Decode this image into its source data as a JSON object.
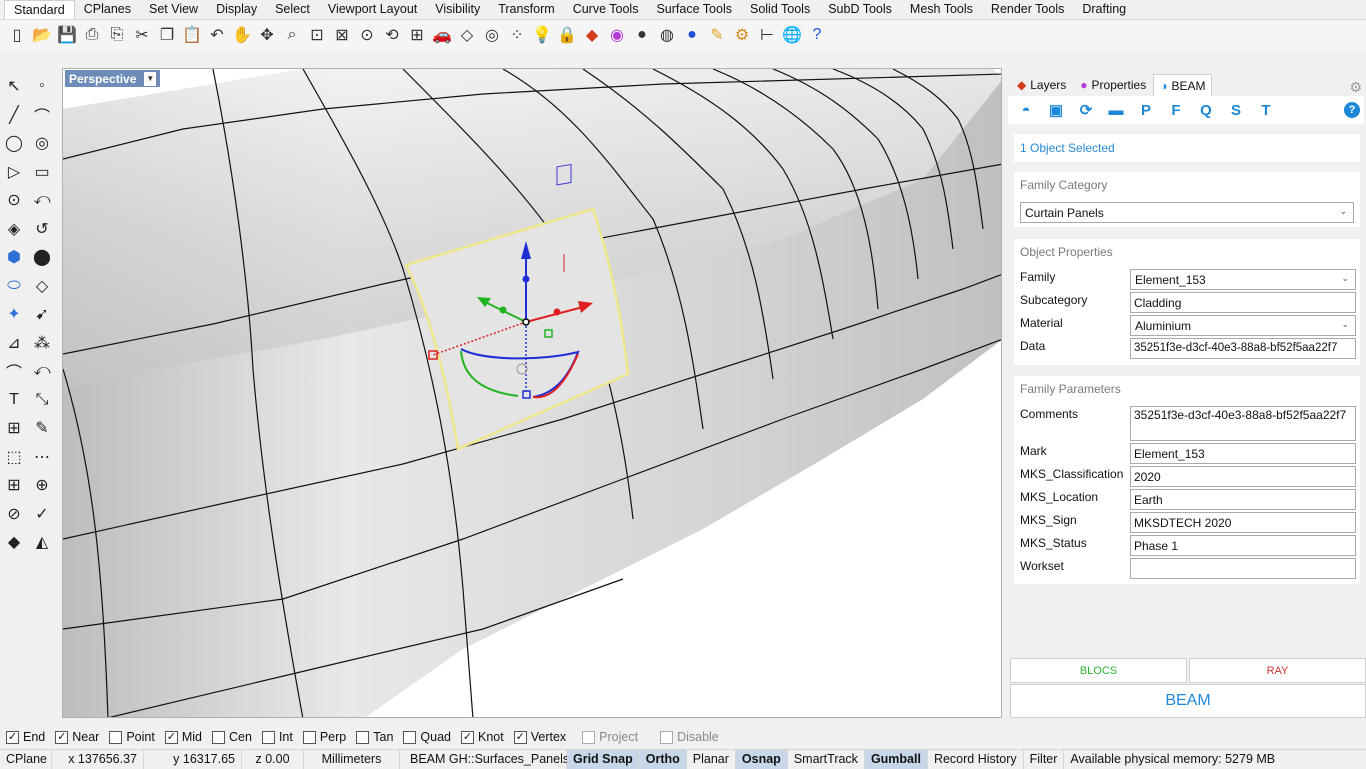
{
  "tabs": [
    "Standard",
    "CPlanes",
    "Set View",
    "Display",
    "Select",
    "Viewport Layout",
    "Visibility",
    "Transform",
    "Curve Tools",
    "Surface Tools",
    "Solid Tools",
    "SubD Tools",
    "Mesh Tools",
    "Render Tools",
    "Drafting"
  ],
  "toolbar_icons": [
    "new-file",
    "open",
    "save",
    "print",
    "import",
    "cut",
    "copy",
    "paste",
    "undo",
    "pan",
    "rotate-view",
    "zoom",
    "zoom-window",
    "zoom-extents",
    "zoom-selected",
    "rotate",
    "four-viewports",
    "car",
    "construction-plane",
    "circle-snap",
    "point-select",
    "light",
    "lock",
    "layer",
    "color-wheel",
    "sphere-shade",
    "sphere-render",
    "sphere-blue",
    "brush",
    "gear",
    "dimension",
    "globe",
    "help"
  ],
  "viewport": {
    "label": "Perspective"
  },
  "right_panel": {
    "tabs": [
      "Layers",
      "Properties",
      "BEAM"
    ],
    "beam_letters": [
      "P",
      "F",
      "Q",
      "S",
      "T"
    ],
    "selection": "1 Object Selected",
    "family_category": {
      "title": "Family Category",
      "value": "Curtain Panels"
    },
    "object_properties": {
      "title": "Object Properties",
      "family_label": "Family",
      "family_value": "Element_153",
      "subcategory_label": "Subcategory",
      "subcategory_value": "Cladding",
      "material_label": "Material",
      "material_value": "Aluminium",
      "data_label": "Data",
      "data_value": "35251f3e-d3cf-40e3-88a8-bf52f5aa22f7"
    },
    "family_parameters": {
      "title": "Family Parameters",
      "comments_label": "Comments",
      "comments_value": "35251f3e-d3cf-40e3-88a8-bf52f5aa22f7",
      "mark_label": "Mark",
      "mark_value": "Element_153",
      "classification_label": "MKS_Classification",
      "classification_value": "2020",
      "location_label": "MKS_Location",
      "location_value": "Earth",
      "sign_label": "MKS_Sign",
      "sign_value": "MKSDTECH 2020",
      "status_label": "MKS_Status",
      "status_value": "Phase 1",
      "workset_label": "Workset",
      "workset_value": ""
    },
    "buttons": {
      "blocs": "BLOCS",
      "ray": "RAY",
      "beam": "BEAM"
    }
  },
  "osnaps": [
    {
      "label": "End",
      "checked": true
    },
    {
      "label": "Near",
      "checked": true
    },
    {
      "label": "Point",
      "checked": false
    },
    {
      "label": "Mid",
      "checked": true
    },
    {
      "label": "Cen",
      "checked": false
    },
    {
      "label": "Int",
      "checked": false
    },
    {
      "label": "Perp",
      "checked": false
    },
    {
      "label": "Tan",
      "checked": false
    },
    {
      "label": "Quad",
      "checked": false
    },
    {
      "label": "Knot",
      "checked": true
    },
    {
      "label": "Vertex",
      "checked": true
    },
    {
      "label": "Project",
      "checked": false,
      "dim": true
    },
    {
      "label": "Disable",
      "checked": false,
      "dim": true
    }
  ],
  "statusbar": {
    "cplane": "CPlane",
    "x": "x 137656.37",
    "y": "y 16317.65",
    "z": "z 0.00",
    "units": "Millimeters",
    "layer": "BEAM GH::Surfaces_Panels",
    "grid_snap": "Grid Snap",
    "ortho": "Ortho",
    "planar": "Planar",
    "osnap": "Osnap",
    "smarttrack": "SmartTrack",
    "gumball": "Gumball",
    "record_history": "Record History",
    "filter": "Filter",
    "memory": "Available physical memory: 5279 MB"
  },
  "colors": {
    "accent": "#1e88d8",
    "viewport_label_bg": "#6d8db8",
    "blocs": "#2db52d",
    "ray": "#d63333",
    "selection": "#f0e68c"
  }
}
